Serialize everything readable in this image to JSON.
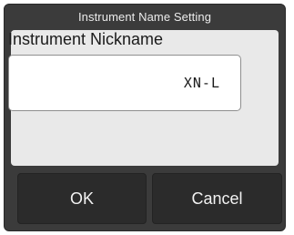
{
  "dialog": {
    "title": "Instrument Name Setting"
  },
  "form": {
    "label": "Instrument Nickname",
    "value": "XN-L"
  },
  "buttons": {
    "ok_label": "OK",
    "cancel_label": "Cancel"
  },
  "colors": {
    "dialog_bg": "#3b3b3b",
    "panel_bg": "#e9e9e9",
    "button_bg": "#2b2b2b",
    "title_text": "#ececec"
  }
}
